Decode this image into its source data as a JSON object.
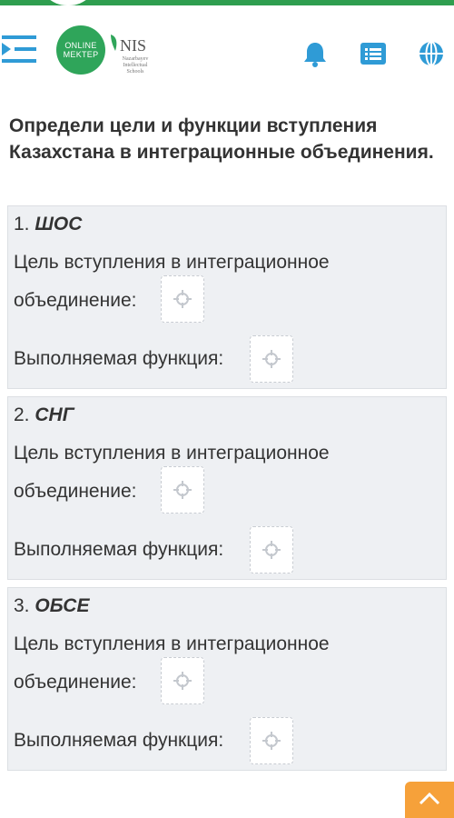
{
  "header": {
    "logo_online": "ONLINE",
    "logo_mektep": "MEKTEP",
    "nis_title": "NIS",
    "nis_subtitle_1": "Nazarbayev",
    "nis_subtitle_2": "Intellectual",
    "nis_subtitle_3": "Schools",
    "icons": [
      "menu-icon",
      "bell-icon",
      "list-icon",
      "globe-icon"
    ]
  },
  "question": "Определи цели и функции вступления Казахстана в интеграционные объединения.",
  "cards": [
    {
      "number": "1.",
      "name": "ШОС",
      "goal_line1": "Цель вступления в интеграционное",
      "goal_line2": "объединение:",
      "function_label": "Выполняемая функция:"
    },
    {
      "number": "2.",
      "name": "СНГ",
      "goal_line1": "Цель вступления в интеграционное",
      "goal_line2": "объединение:",
      "function_label": "Выполняемая функция:"
    },
    {
      "number": "3.",
      "name": "ОБСЕ",
      "goal_line1": "Цель вступления в интеграционное",
      "goal_line2": "объединение:",
      "function_label": "Выполняемая функция:"
    }
  ],
  "colors": {
    "brand_green": "#2fa55a",
    "bell": "#2f9bd6",
    "next_button": "#f6a13a",
    "card_bg": "#eef0f3"
  }
}
